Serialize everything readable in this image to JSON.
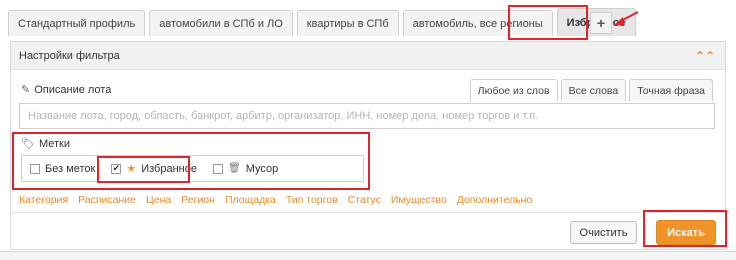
{
  "tabs": [
    {
      "label": "Стандартный профиль",
      "active": false
    },
    {
      "label": "автомобили в СПб и ЛО",
      "active": false
    },
    {
      "label": "квартиры в СПб",
      "active": false
    },
    {
      "label": "автомобиль, все регионы",
      "active": false
    },
    {
      "label": "Избранное",
      "active": true
    }
  ],
  "add_tab_label": "+",
  "filter_panel": {
    "title": "Настройки фильтра",
    "collapse_icon": "chevron-up-double-icon"
  },
  "lot_description": {
    "label": "Описание лота",
    "icon": "pencil-icon",
    "modes": [
      "Любое из слов",
      "Все слова",
      "Точная фраза"
    ],
    "active_mode": "Любое из слов",
    "placeholder": "Название лота, город, область, банкрот, арбитр, организатор, ИНН, номер дела, номер торгов и т.п."
  },
  "labels": {
    "label": "Метки",
    "icon": "tags-icon",
    "items": [
      {
        "label": "Без меток",
        "checked": false,
        "icon": ""
      },
      {
        "label": "Избранное",
        "checked": true,
        "icon": "star-icon"
      },
      {
        "label": "Мусор",
        "checked": false,
        "icon": "trash-icon"
      }
    ]
  },
  "filter_links": [
    "Категория",
    "Расписание",
    "Цена",
    "Регион",
    "Площадка",
    "Тип торгов",
    "Статус",
    "Имущество",
    "Дополнительно"
  ],
  "buttons": {
    "clear": "Очистить",
    "search": "Искать"
  },
  "colors": {
    "accent": "#f0932b",
    "highlight": "#e0242a"
  }
}
